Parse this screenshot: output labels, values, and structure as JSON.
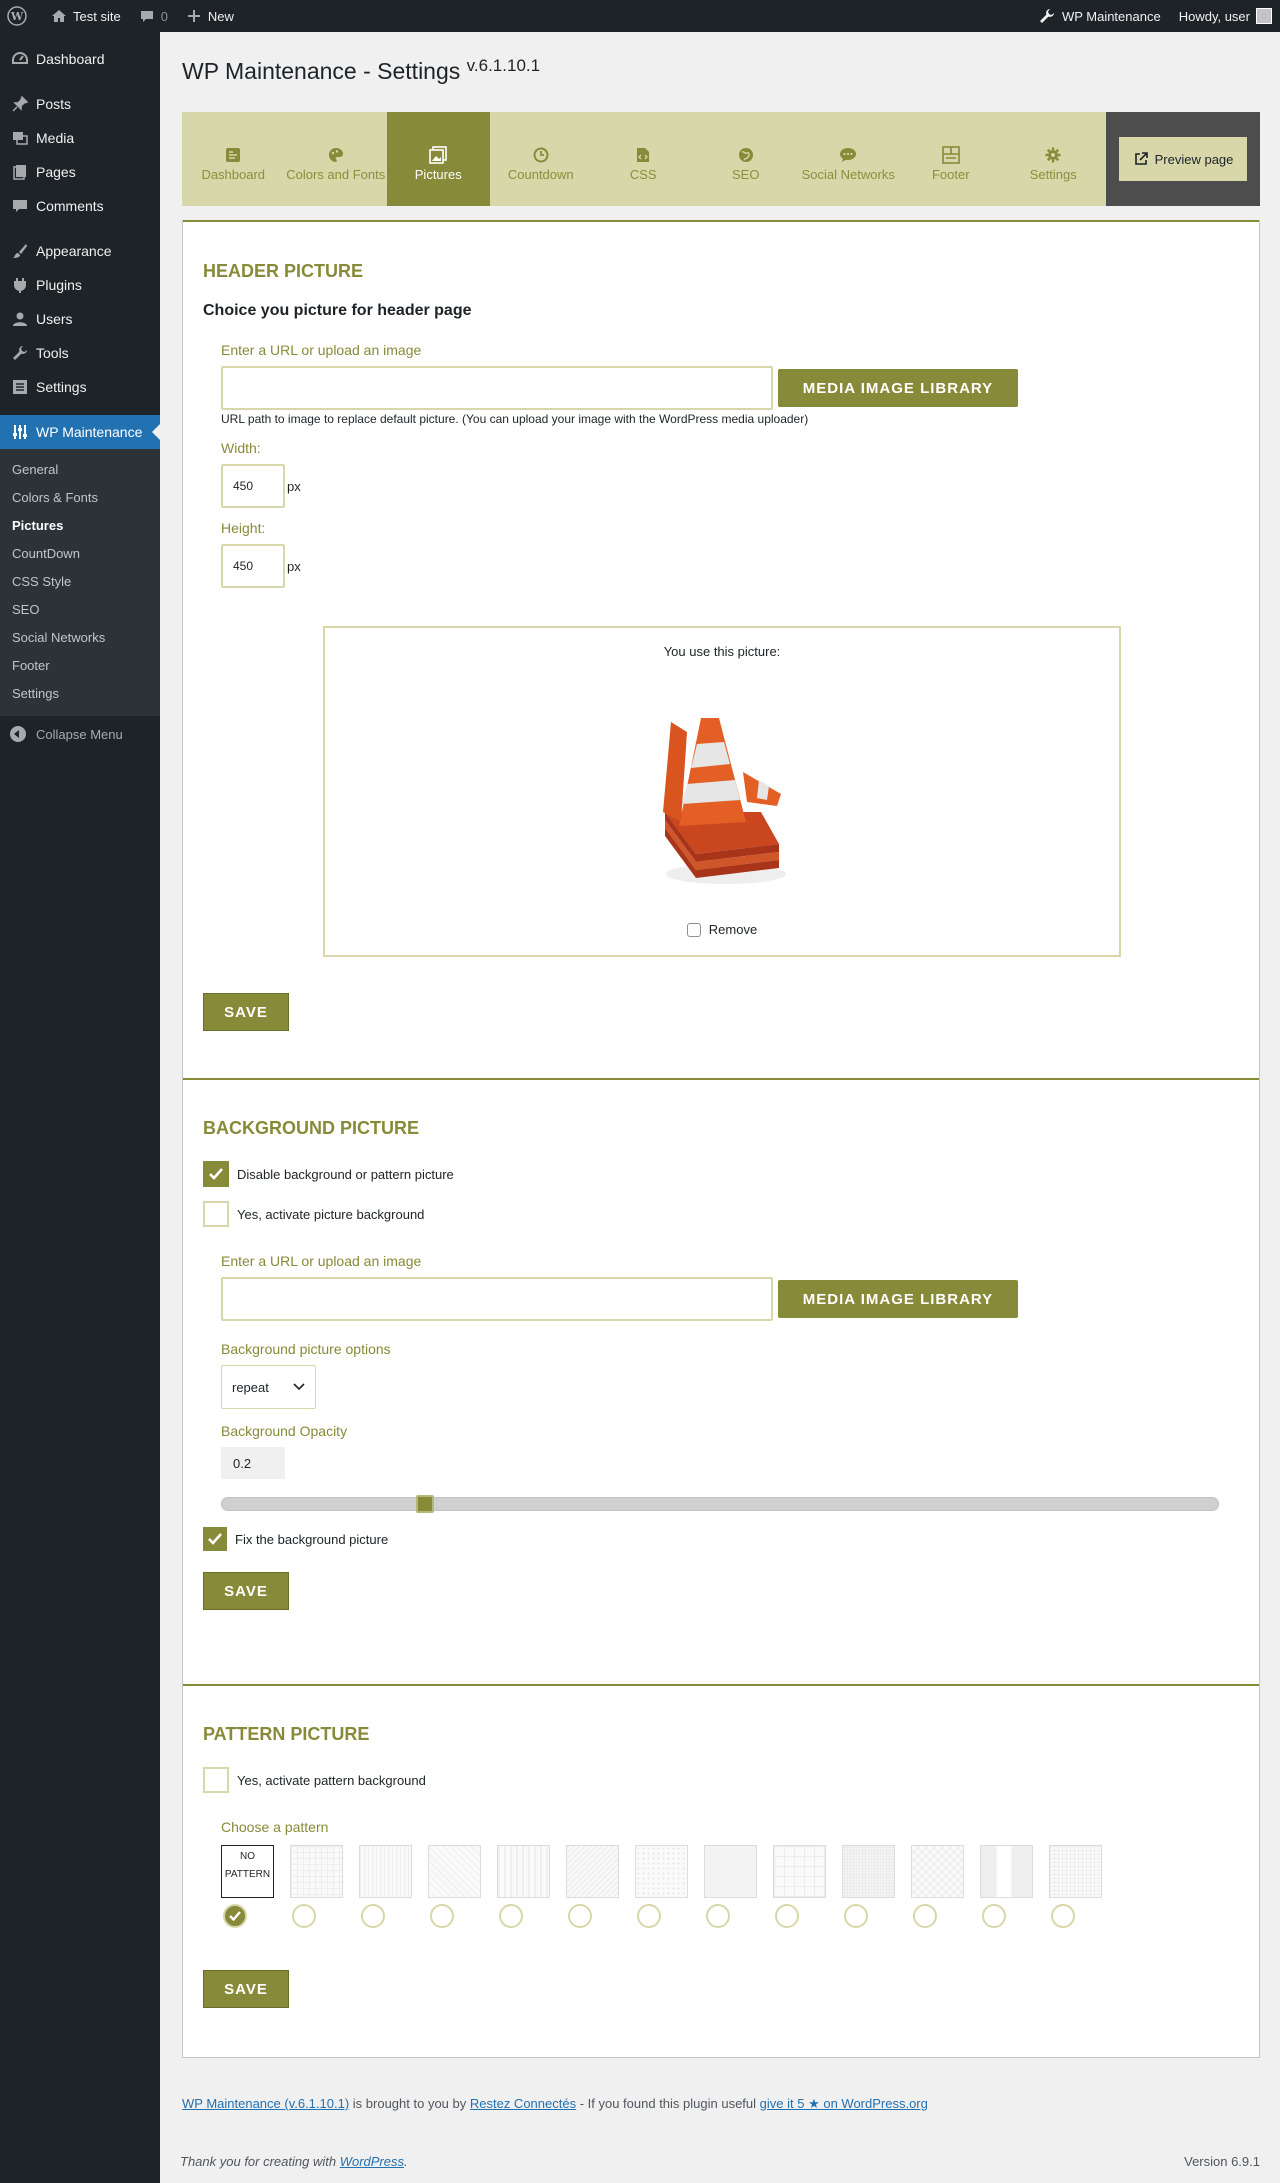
{
  "adminbar": {
    "site_name": "Test site",
    "comments_count": "0",
    "new_label": "New",
    "plugin_label": "WP Maintenance",
    "howdy": "Howdy, user"
  },
  "sidebar": {
    "items": [
      {
        "label": "Dashboard",
        "icon": "dashboard-icon"
      },
      {
        "label": "Posts",
        "icon": "pin-icon"
      },
      {
        "label": "Media",
        "icon": "media-icon"
      },
      {
        "label": "Pages",
        "icon": "pages-icon"
      },
      {
        "label": "Comments",
        "icon": "comment-icon"
      },
      {
        "label": "Appearance",
        "icon": "brush-icon"
      },
      {
        "label": "Plugins",
        "icon": "plug-icon"
      },
      {
        "label": "Users",
        "icon": "user-icon"
      },
      {
        "label": "Tools",
        "icon": "wrench-icon"
      },
      {
        "label": "Settings",
        "icon": "settings-icon"
      },
      {
        "label": "WP Maintenance",
        "icon": "sliders-icon"
      }
    ],
    "submenu": [
      "General",
      "Colors & Fonts",
      "Pictures",
      "CountDown",
      "CSS Style",
      "SEO",
      "Social Networks",
      "Footer",
      "Settings"
    ],
    "collapse": "Collapse Menu"
  },
  "page": {
    "title": "WP Maintenance - Settings",
    "version": "v.6.1.10.1"
  },
  "tabs": [
    {
      "label": "Dashboard",
      "icon": "dashboard-icon"
    },
    {
      "label": "Colors and Fonts",
      "icon": "palette-icon"
    },
    {
      "label": "Pictures",
      "icon": "images-icon"
    },
    {
      "label": "Countdown",
      "icon": "clock-icon"
    },
    {
      "label": "CSS",
      "icon": "css-file-icon"
    },
    {
      "label": "SEO",
      "icon": "globe-icon"
    },
    {
      "label": "Social Networks",
      "icon": "chat-icon"
    },
    {
      "label": "Footer",
      "icon": "layout-icon"
    },
    {
      "label": "Settings",
      "icon": "gear-icon"
    }
  ],
  "preview_label": "Preview page",
  "header_section": {
    "title": "HEADER PICTURE",
    "subtitle": "Choice you picture for header page",
    "url_label": "Enter a URL or upload an image",
    "media_button": "MEDIA IMAGE LIBRARY",
    "help": "URL path to image to replace default picture. (You can upload your image with the WordPress media uploader)",
    "width_label": "Width:",
    "width_value": "450",
    "height_label": "Height:",
    "height_value": "450",
    "unit": "px",
    "preview_label": "You use this picture:",
    "remove_label": "Remove",
    "save": "SAVE"
  },
  "background_section": {
    "title": "BACKGROUND PICTURE",
    "disable_label": "Disable background or pattern picture",
    "activate_label": "Yes, activate picture background",
    "url_label": "Enter a URL or upload an image",
    "media_button": "MEDIA IMAGE LIBRARY",
    "options_label": "Background picture options",
    "options_value": "repeat",
    "opacity_label": "Background Opacity",
    "opacity_value": "0.2",
    "fix_label": "Fix the background picture",
    "save": "SAVE"
  },
  "pattern_section": {
    "title": "PATTERN PICTURE",
    "activate_label": "Yes, activate pattern background",
    "choose_label": "Choose a pattern",
    "no_pattern": "NO PATTERN",
    "selected_index": 0,
    "save": "SAVE"
  },
  "footer": {
    "plugin_link": "WP Maintenance (v.6.1.10.1)",
    "brought": " is brought to you by ",
    "author_link": "Restez Connectés",
    "useful": " - If you found this plugin useful ",
    "rate_link": "give it 5 ★ on WordPress.org",
    "thanks": "Thank you for creating with ",
    "wp_link": "WordPress",
    "thanks_end": ".",
    "version": "Version 6.9.1"
  },
  "colors": {
    "accent": "#878a38",
    "tab_bg": "#d7d7a9",
    "wp_blue": "#2271b1"
  }
}
